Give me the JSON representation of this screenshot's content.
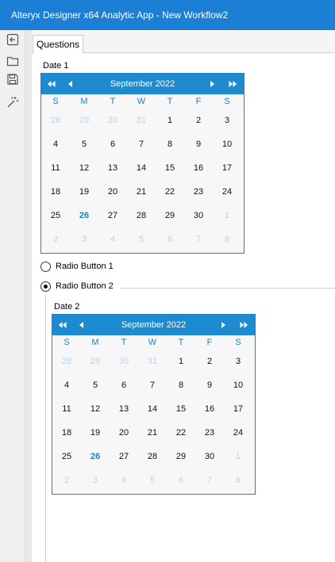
{
  "window": {
    "title": "Alteryx Designer x64 Analytic App - New Workflow2"
  },
  "toolbar": {
    "tools": [
      {
        "name": "back-icon"
      },
      {
        "name": "folder-icon"
      },
      {
        "name": "save-icon"
      },
      {
        "name": "magic-wand-icon"
      }
    ]
  },
  "tabs": [
    {
      "label": "Questions"
    }
  ],
  "date1": {
    "label": "Date 1",
    "month_label": "September 2022",
    "weekdays": [
      "S",
      "M",
      "T",
      "W",
      "T",
      "F",
      "S"
    ],
    "weeks": [
      [
        "28",
        "29",
        "30",
        "31",
        "1",
        "2",
        "3"
      ],
      [
        "4",
        "5",
        "6",
        "7",
        "8",
        "9",
        "10"
      ],
      [
        "11",
        "12",
        "13",
        "14",
        "15",
        "16",
        "17"
      ],
      [
        "18",
        "19",
        "20",
        "21",
        "22",
        "23",
        "24"
      ],
      [
        "25",
        "26",
        "27",
        "28",
        "29",
        "30",
        "1"
      ],
      [
        "2",
        "3",
        "4",
        "5",
        "6",
        "7",
        "8"
      ]
    ],
    "today": "26"
  },
  "radios": [
    {
      "label": "Radio Button 1",
      "selected": false
    },
    {
      "label": "Radio Button 2",
      "selected": true
    }
  ],
  "date2": {
    "label": "Date 2",
    "month_label": "September 2022",
    "weekdays": [
      "S",
      "M",
      "T",
      "W",
      "T",
      "F",
      "S"
    ],
    "weeks": [
      [
        "28",
        "29",
        "30",
        "31",
        "1",
        "2",
        "3"
      ],
      [
        "4",
        "5",
        "6",
        "7",
        "8",
        "9",
        "10"
      ],
      [
        "11",
        "12",
        "13",
        "14",
        "15",
        "16",
        "17"
      ],
      [
        "18",
        "19",
        "20",
        "21",
        "22",
        "23",
        "24"
      ],
      [
        "25",
        "26",
        "27",
        "28",
        "29",
        "30",
        "1"
      ],
      [
        "2",
        "3",
        "4",
        "5",
        "6",
        "7",
        "8"
      ]
    ],
    "today": "26"
  },
  "colors": {
    "titlebar": "#1c7fd6",
    "calendar_header": "#1e8ad0",
    "weekday_text": "#1e7fbf",
    "other_month_text": "#b6d5ea",
    "today_text": "#1c7fbf"
  }
}
